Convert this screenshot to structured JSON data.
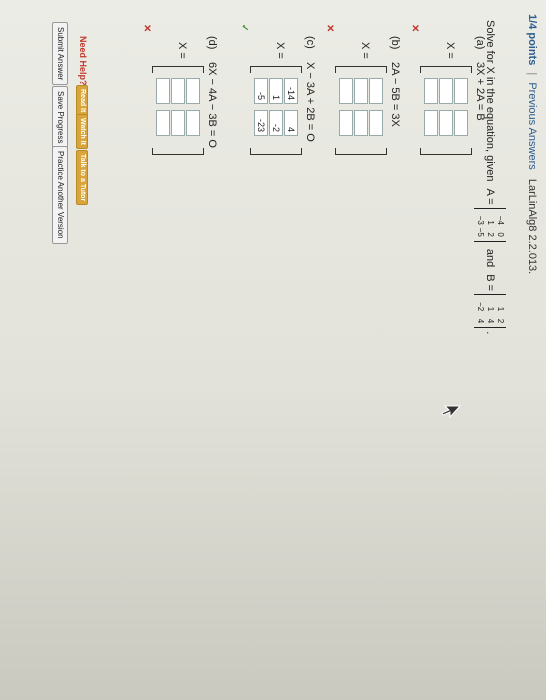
{
  "header": {
    "points": "1/4 points",
    "separator": "|",
    "previous_answers": "Previous Answers",
    "reference": "LarLinAlg8 2.2.013."
  },
  "question": {
    "text": "Solve for X in the equation, given",
    "a_label": "A =",
    "and_label": "and",
    "b_label": "B =",
    "period": ".",
    "matrix_a": [
      [
        "−4",
        "0"
      ],
      [
        "1",
        "2"
      ],
      [
        "−3",
        "−5"
      ]
    ],
    "matrix_b": [
      [
        "1",
        "2"
      ],
      [
        "1",
        "4"
      ],
      [
        "−2",
        "4"
      ]
    ]
  },
  "parts": [
    {
      "label": "(a)",
      "equation": "3X + 2A = B",
      "x_label": "X =",
      "cells": [
        "",
        "",
        "",
        "",
        "",
        ""
      ],
      "status": "incorrect",
      "status_mark": "✕"
    },
    {
      "label": "(b)",
      "equation": "2A − 5B = 3X",
      "x_label": "X =",
      "cells": [
        "",
        "",
        "",
        "",
        "",
        ""
      ],
      "status": "incorrect",
      "status_mark": "✕"
    },
    {
      "label": "(c)",
      "equation": "X − 3A + 2B = O",
      "x_label": "X =",
      "cells": [
        "-14",
        "4",
        "1",
        "-2",
        "-5",
        "-23"
      ],
      "status": "correct",
      "status_mark": "✓"
    },
    {
      "label": "(d)",
      "equation": "6X − 4A − 3B = O",
      "x_label": "X =",
      "cells": [
        "",
        "",
        "",
        "",
        "",
        ""
      ],
      "status": "incorrect",
      "status_mark": "✕"
    }
  ],
  "help": {
    "label": "Need Help?",
    "buttons": [
      "Read It",
      "Watch It",
      "Talk to a Tutor"
    ]
  },
  "actions": {
    "submit": "Submit Answer",
    "save": "Save Progress",
    "practice": "Practice Another Version"
  },
  "colors": {
    "link": "#2c5d8f",
    "incorrect": "#c0392b",
    "correct": "#3a8a2e",
    "help_button": "#d9a53a"
  }
}
